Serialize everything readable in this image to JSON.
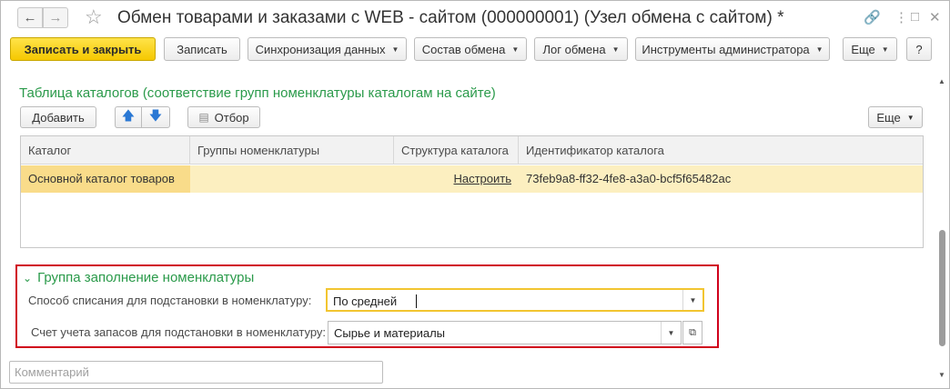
{
  "window": {
    "title": "Обмен товарами и заказами с WEB - сайтом (000000001) (Узел обмена с сайтом) *",
    "icons": {
      "back": "arrow-left-icon",
      "forward": "arrow-right-icon",
      "favorite": "star-icon",
      "link": "link-icon",
      "menu": "more-vertical-icon",
      "minimize": "minimize-icon",
      "close": "close-icon"
    }
  },
  "toolbar": {
    "save_close": "Записать и закрыть",
    "save": "Записать",
    "sync": "Синхронизация данных",
    "composition": "Состав обмена",
    "log": "Лог обмена",
    "admin_tools": "Инструменты администратора",
    "more": "Еще",
    "help": "?"
  },
  "catalogs": {
    "section_title": "Таблица каталогов (соответствие групп номенклатуры каталогам на сайте)",
    "add_button": "Добавить",
    "filter_button": "Отбор",
    "more_button": "Еще",
    "columns": [
      "Каталог",
      "Группы номенклатуры",
      "Структура каталога",
      "Идентификатор каталога"
    ],
    "rows": [
      {
        "catalog": "Основной каталог товаров",
        "groups": "",
        "structure": "Настроить",
        "id": "73feb9a8-ff32-4fe8-a3a0-bcf5f65482ac"
      }
    ]
  },
  "nomenclature_group": {
    "title": "Группа заполнение номенклатуры",
    "write_off_label": "Способ списания для подстановки в номенклатуру:",
    "write_off_value": "По средней",
    "account_label": "Счет учета запасов для подстановки в номенклатуру:",
    "account_value": "Сырье и материалы"
  },
  "comment": {
    "placeholder": "Комментарий",
    "value": ""
  },
  "colors": {
    "accent_yellow": "#f5c800",
    "section_green": "#2a9a4a",
    "highlight_border": "#d0021b",
    "selected_row": "#fcefc0"
  }
}
